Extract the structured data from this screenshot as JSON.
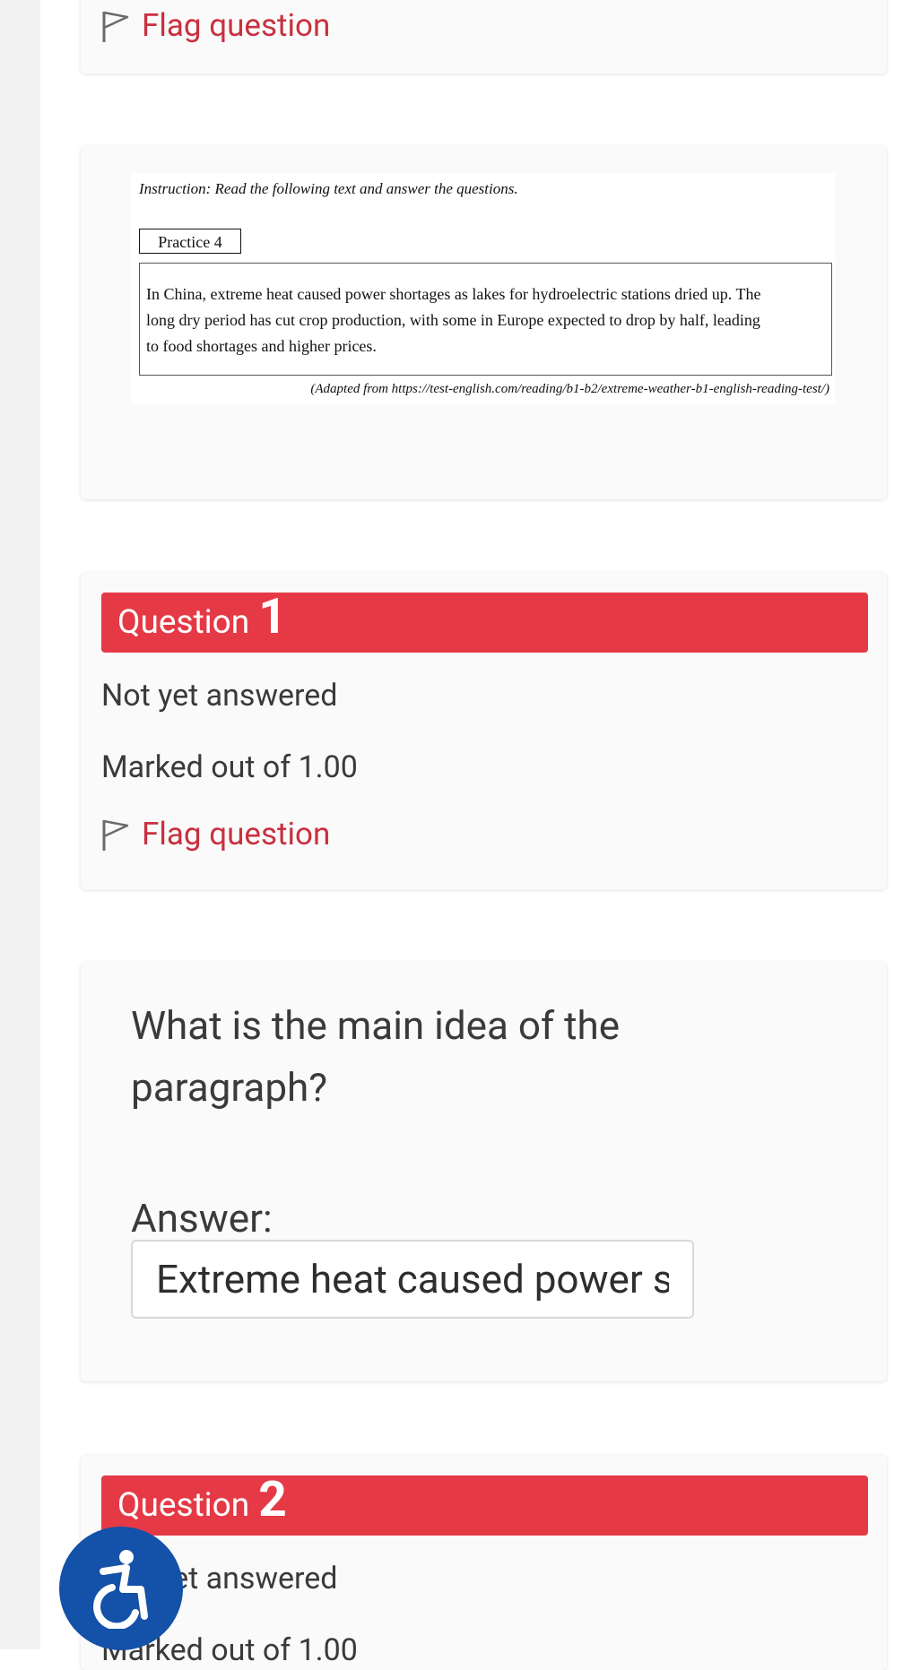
{
  "flag_label": "Flag question",
  "passage": {
    "instruction": "Instruction: Read the following text and answer the questions.",
    "practice": "Practice 4",
    "paragraph_line1": "In China, extreme heat caused power shortages as lakes for hydroelectric stations dried up. The",
    "paragraph_line2": "long dry period has cut crop production, with some in Europe expected to drop by half, leading",
    "paragraph_line3": "to food shortages and higher prices.",
    "source": "(Adapted from https://test-english.com/reading/b1-b2/extreme-weather-b1-english-reading-test/)"
  },
  "question1": {
    "word": "Question",
    "number": "1",
    "status": "Not yet answered",
    "marked": "Marked out of 1.00",
    "flag": "Flag question"
  },
  "question1_body": {
    "text": "What is the main idea of the paragraph?",
    "answer_label": "Answer:",
    "answer_value": "Extreme heat caused power shortages"
  },
  "question2": {
    "word": "Question",
    "number": "2",
    "status": "Not yet answered",
    "marked": "Marked out of 1.00"
  },
  "colors": {
    "accent_red": "#e63946",
    "flag_red": "#c9303f",
    "a11y_blue": "#1451a8"
  },
  "icons": {
    "flag": "flag-outline-icon",
    "accessibility": "wheelchair-accessibility-icon"
  }
}
